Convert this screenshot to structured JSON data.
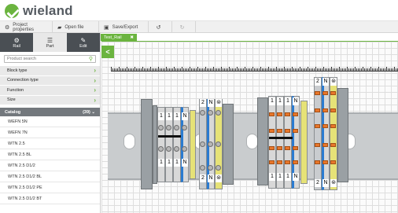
{
  "app": {
    "logo_text": "wieland",
    "brand_color": "#6bb43f"
  },
  "toolbar": {
    "project_properties": "Project properties",
    "open_file": "Open file",
    "save_export": "Save/Export",
    "undo_icon": "undo-icon",
    "redo_icon": "redo-icon"
  },
  "left_panel": {
    "tabs": [
      {
        "label": "Rail",
        "icon": "gear-icon"
      },
      {
        "label": "Part",
        "icon": "list-icon"
      },
      {
        "label": "Edit",
        "icon": "pencil-icon"
      }
    ],
    "search_placeholder": "Product search",
    "filters": [
      "Block type",
      "Connection type",
      "Function",
      "Size"
    ],
    "catalog": {
      "title": "Catalog",
      "count": "(39)",
      "items": [
        "WEFN 5N",
        "WEFN 7N",
        "WTN 2.5",
        "WTN 2.5 BL",
        "WTN 2.5 D1/2",
        "WTN 2.5 D1/2 BL",
        "WTN 2.5 D1/2 PE",
        "WTN 2.5 D1/2 BT"
      ]
    }
  },
  "document_tab": {
    "label": "Test_Rail",
    "close": "✖"
  },
  "canvas": {
    "collapse": "<",
    "group1_top": [
      "1",
      "1",
      "1",
      "N"
    ],
    "group1_bottom": [
      "1",
      "1",
      "1",
      "N"
    ],
    "group1_pe_top": [
      "2",
      "N",
      "⊜"
    ],
    "group1_pe_bottom": [
      "2",
      "N",
      "⊜"
    ],
    "group2_top": [
      "1",
      "1",
      "1",
      "N"
    ],
    "group2_bottom": [
      "1",
      "1",
      "1",
      "N"
    ],
    "group2_pe_top": [
      "2",
      "N",
      "⊜"
    ],
    "group2_pe_bottom": [
      "2",
      "N",
      "⊜"
    ]
  }
}
